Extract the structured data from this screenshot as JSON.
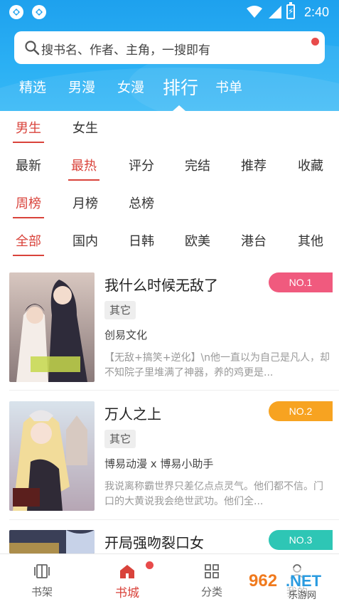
{
  "status_bar": {
    "time": "2:40"
  },
  "search": {
    "placeholder": "搜书名、作者、主角，一搜即有"
  },
  "channels": [
    "精选",
    "男漫",
    "女漫",
    "排行",
    "书单"
  ],
  "filters": {
    "gender": [
      "男生",
      "女生"
    ],
    "sort": [
      "最新",
      "最热",
      "评分",
      "完结",
      "推荐",
      "收藏"
    ],
    "period": [
      "周榜",
      "月榜",
      "总榜"
    ],
    "region": [
      "全部",
      "国内",
      "日韩",
      "欧美",
      "港台",
      "其他"
    ]
  },
  "books": [
    {
      "title": "我什么时候无敌了",
      "tag": "其它",
      "author": "创易文化",
      "desc": "【无敌+搞笑+逆化】\\n他一直以为自己是凡人，却不知院子里堆满了神器，养的鸡更是...",
      "rank": "NO.1",
      "rank_color": "#f05a7e"
    },
    {
      "title": "万人之上",
      "tag": "其它",
      "author": "博易动漫 x 博易小助手",
      "desc": "我说离称霸世界只差亿点点灵气。他们都不信。门口的大黄说我会绝世武功。他们全...",
      "rank": "NO.2",
      "rank_color": "#f7a321"
    },
    {
      "title": "开局强吻裂口女",
      "tag": "",
      "author": "",
      "desc": "",
      "rank": "NO.3",
      "rank_color": "#2ec6b5"
    }
  ],
  "bottom_nav": [
    "书架",
    "书城",
    "分类",
    "我的"
  ],
  "watermark": {
    "text": "962.NET",
    "sub": "乐游网"
  },
  "colors": {
    "accent": "#d9433b",
    "header_blue": "#1ea1ee"
  }
}
